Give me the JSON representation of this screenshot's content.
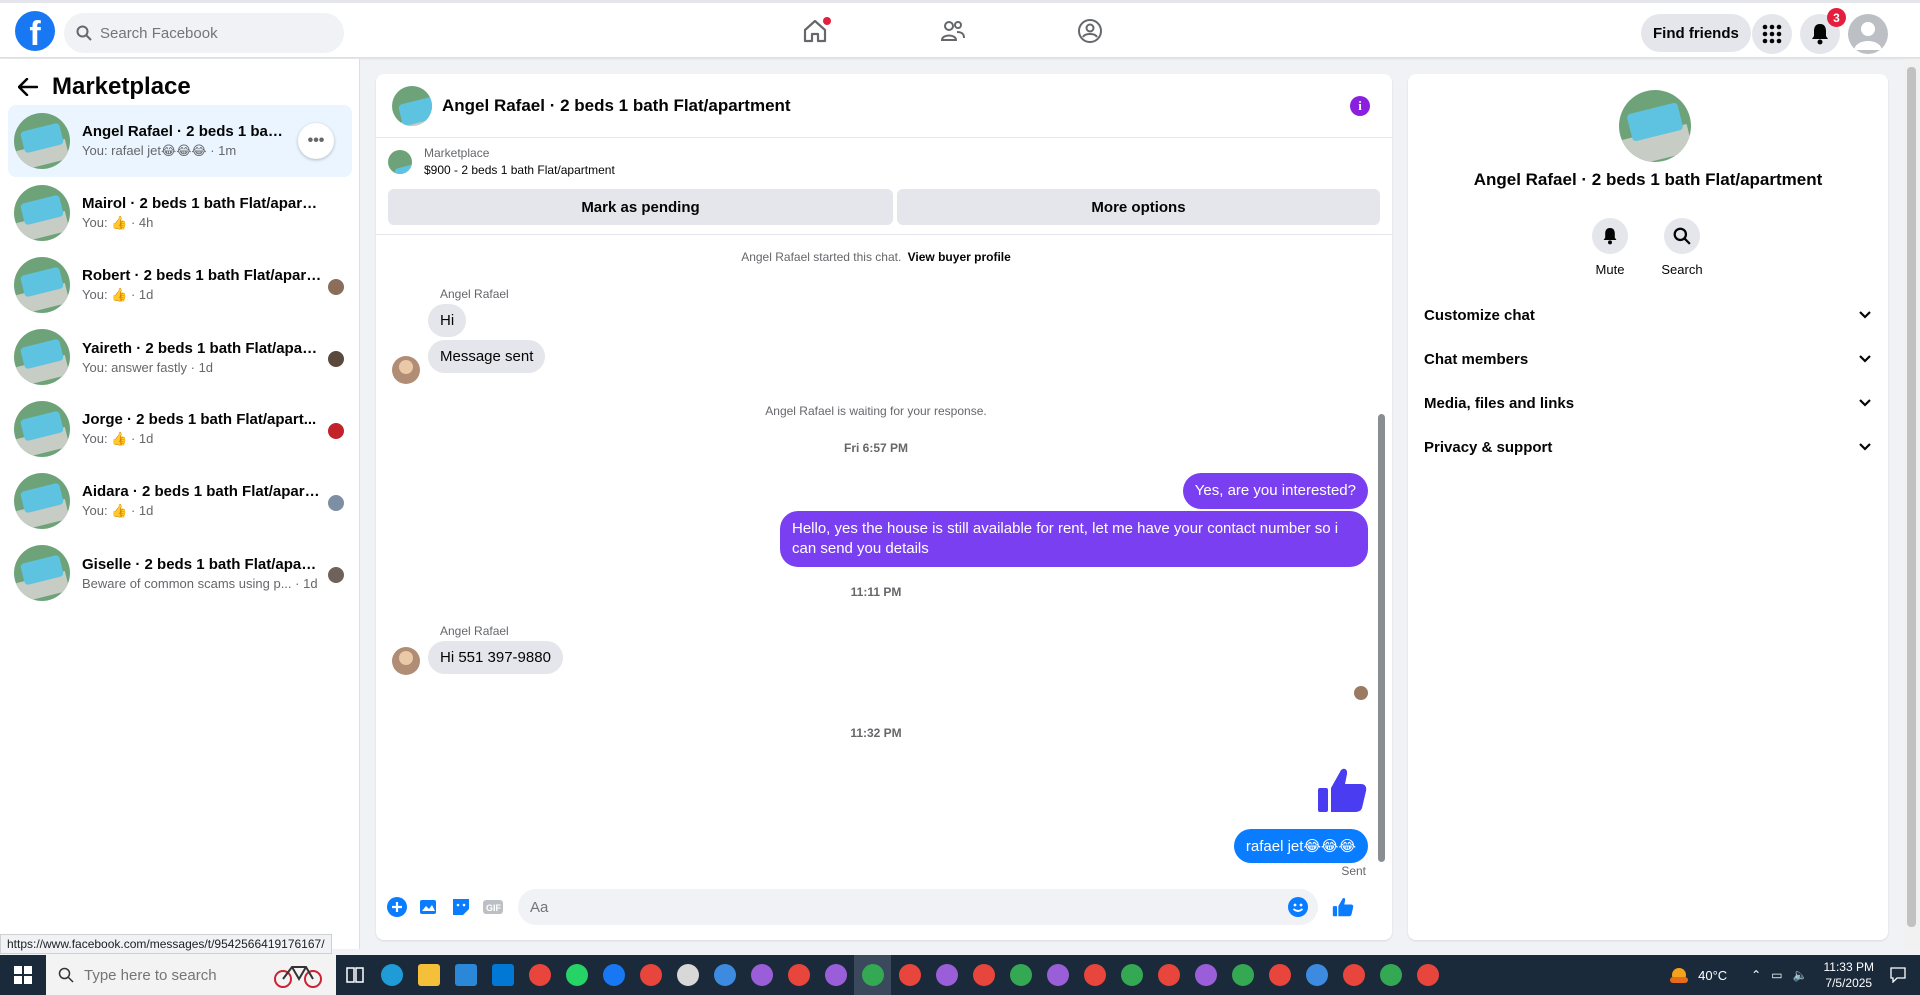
{
  "colors": {
    "facebook_blue": "#1877f2",
    "outgoing_bubble": "#7b3ff2",
    "sent_bubble": "#0a7cff",
    "badge_red": "#e41e3f"
  },
  "topnav": {
    "search_placeholder": "Search Facebook",
    "find_friends": "Find friends",
    "notification_count": "3"
  },
  "sidebar": {
    "title": "Marketplace",
    "conversations": [
      {
        "title": "Angel Rafael · 2 beds 1 bath Flat/apartment",
        "subtitle": "You: rafael jet😂😂😂 · 1m"
      },
      {
        "title": "Mairol · 2 beds 1 bath Flat/apartm...",
        "subtitle": "You: 👍 · 4h"
      },
      {
        "title": "Robert · 2 beds 1 bath Flat/apart...",
        "subtitle": "You: 👍 · 1d"
      },
      {
        "title": "Yaireth · 2 beds 1 bath Flat/apart...",
        "subtitle": "You: answer fastly · 1d"
      },
      {
        "title": "Jorge · 2 beds 1 bath Flat/apart...",
        "subtitle": "You: 👍 · 1d"
      },
      {
        "title": "Aidara · 2 beds 1 bath Flat/apart...",
        "subtitle": "You: 👍 · 1d"
      },
      {
        "title": "Giselle · 2 beds 1 bath Flat/apart...",
        "subtitle": "Beware of common scams using p... · 1d"
      }
    ],
    "status_url": "https://www.facebook.com/messages/t/9542566419176167/"
  },
  "chat": {
    "title": "Angel Rafael · 2 beds 1 bath Flat/apartment",
    "listing_category": "Marketplace",
    "listing_detail": "$900 - 2 beds 1 bath Flat/apartment",
    "mark_pending": "Mark as pending",
    "more_options": "More options",
    "started_text": "Angel Rafael started this chat.",
    "view_profile": "View buyer profile",
    "sender_name": "Angel Rafael",
    "msg_hi": "Hi",
    "msg_sent": "Message sent",
    "waiting_text": "Angel Rafael is waiting for your response.",
    "time_1": "Fri 6:57 PM",
    "out_1": "Yes, are you interested?",
    "out_2": "Hello, yes the house is still available for rent, let me have your contact number so i can send you details",
    "time_2": "11:11 PM",
    "in_phone": "Hi 551 397-9880",
    "time_3": "11:32 PM",
    "out_3": "rafael jet😂😂😂",
    "sent_status": "Sent",
    "composer_placeholder": "Aa"
  },
  "details": {
    "title": "Angel Rafael · 2 beds 1 bath Flat/apartment",
    "mute": "Mute",
    "search": "Search",
    "items": [
      "Customize chat",
      "Chat members",
      "Media, files and links",
      "Privacy & support"
    ]
  },
  "taskbar": {
    "search_placeholder": "Type here to search",
    "temperature": "40°C",
    "time": "11:33 PM",
    "date": "7/5/2025"
  }
}
